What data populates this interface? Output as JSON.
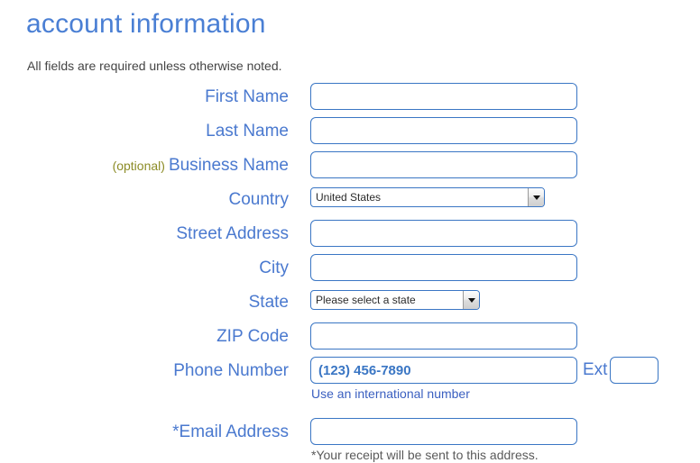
{
  "header": {
    "title": "account information",
    "subtitle": "All fields are required unless otherwise noted."
  },
  "colors": {
    "title": "#4a7fd4",
    "label": "#4a79cf",
    "optional": "#8c8c27",
    "input_border": "#3a76c4",
    "link": "#3a5fc0",
    "note": "#5a5a5a",
    "subtitle": "#444444"
  },
  "form": {
    "first_name": {
      "label": "First Name",
      "value": "",
      "placeholder": ""
    },
    "last_name": {
      "label": "Last Name",
      "value": "",
      "placeholder": ""
    },
    "business_name": {
      "optional_tag": "(optional)",
      "label": "Business Name",
      "value": "",
      "placeholder": ""
    },
    "country": {
      "label": "Country",
      "selected": "United States"
    },
    "street_address": {
      "label": "Street Address",
      "value": "",
      "placeholder": ""
    },
    "city": {
      "label": "City",
      "value": "",
      "placeholder": ""
    },
    "state": {
      "label": "State",
      "selected": "Please select a state"
    },
    "zip_code": {
      "label": "ZIP Code",
      "value": "",
      "placeholder": ""
    },
    "phone_number": {
      "label": "Phone Number",
      "value": "",
      "placeholder": "(123) 456-7890",
      "ext_label": "Ext",
      "ext_value": "",
      "helper_link": "Use an international number"
    },
    "email_address": {
      "label": "Email Address",
      "required_marker": "*",
      "value": "",
      "placeholder": "",
      "note": "*Your receipt will be sent to this address."
    }
  },
  "icons": {
    "select_arrow": "chevron-down-icon"
  }
}
